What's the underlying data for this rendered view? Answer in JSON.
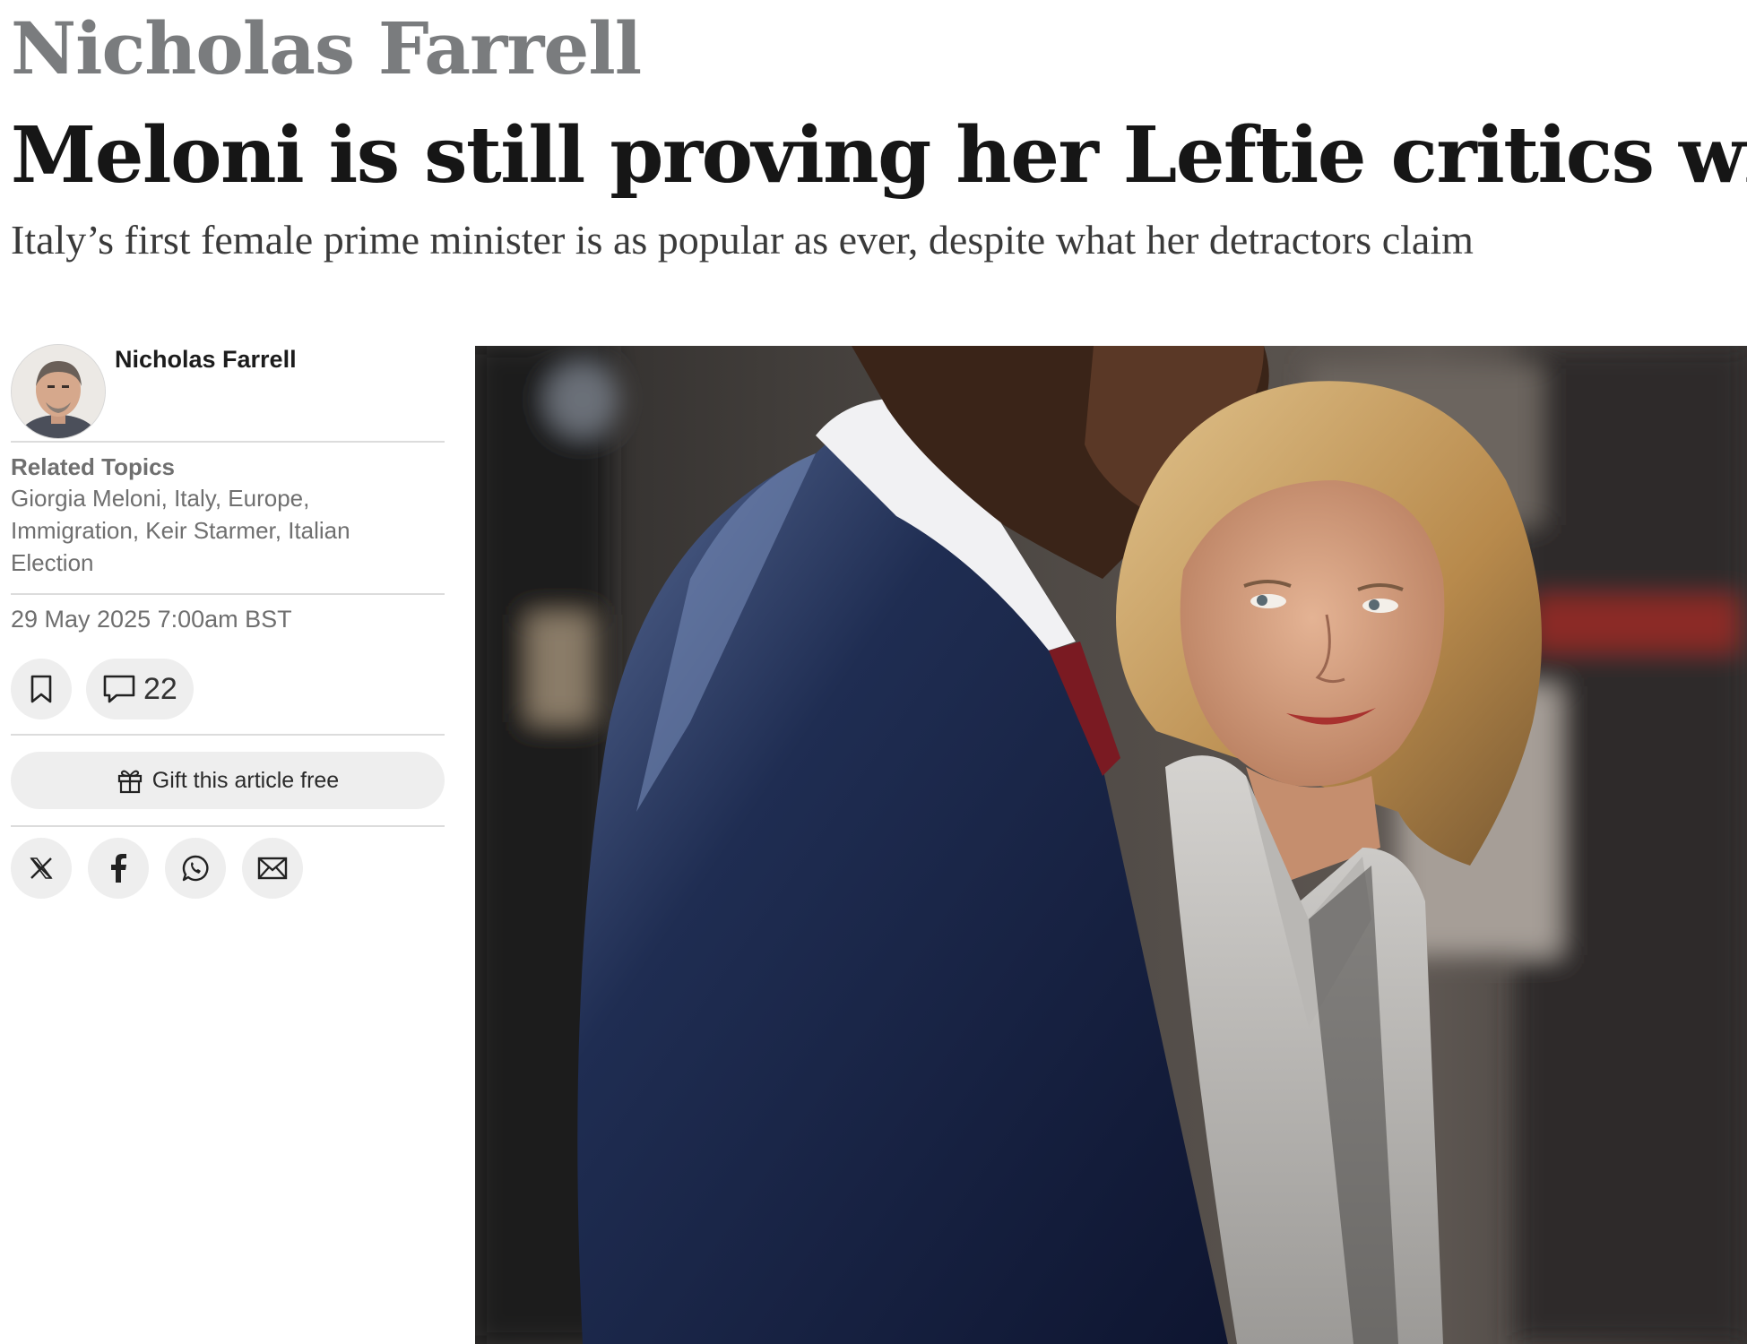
{
  "article": {
    "kicker": "Nicholas Farrell",
    "headline": "Meloni is still proving her Leftie critics wrong",
    "standfirst": "Italy’s first female prime minister is as popular as ever, despite what her detractors claim"
  },
  "byline": {
    "author": "Nicholas Farrell"
  },
  "topics": {
    "label": "Related Topics",
    "list": "Giorgia Meloni, Italy, Europe, Immigration, Keir Starmer, Italian Election"
  },
  "meta": {
    "date": "29 May 2025 7:00am BST",
    "comment_count": "22"
  },
  "actions": {
    "gift_label": "Gift this article free"
  },
  "icons": {
    "bookmark": "bookmark-icon",
    "comment": "comment-icon",
    "gift": "gift-icon",
    "x": "x-icon",
    "facebook": "facebook-icon",
    "whatsapp": "whatsapp-icon",
    "email": "email-icon"
  },
  "colors": {
    "kicker": "#7a7c7e",
    "headline": "#161616",
    "meta_text": "#6f6f6f",
    "button_bg": "#eeeeee"
  }
}
